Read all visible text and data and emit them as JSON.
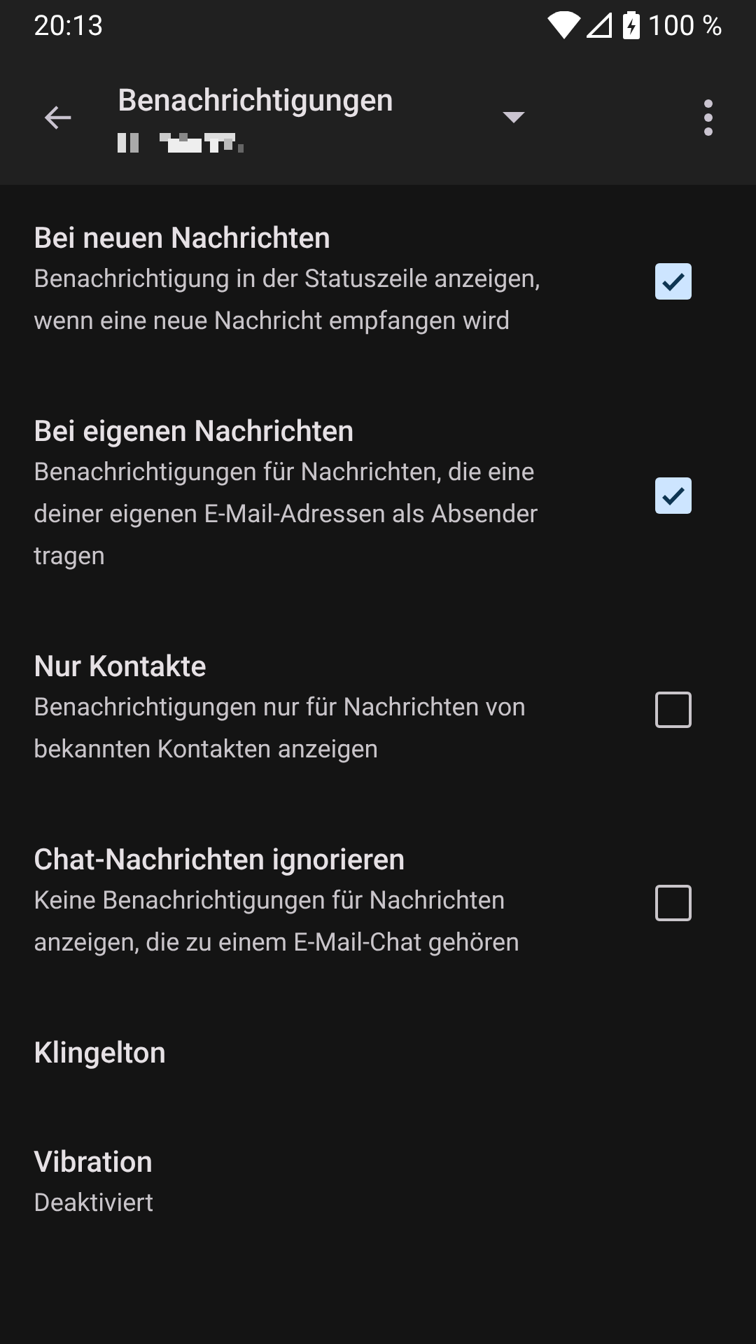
{
  "status_bar": {
    "time": "20:13",
    "battery": "100 %"
  },
  "app_bar": {
    "title": "Benachrichtigungen"
  },
  "settings": [
    {
      "kind": "checkbox",
      "title": "Bei neuen Nachrichten",
      "summary": "Benachrichtigung in der Statuszeile anzeigen, wenn eine neue Nachricht empfangen wird",
      "checked": true
    },
    {
      "kind": "checkbox",
      "title": "Bei eigenen Nachrichten",
      "summary": "Benachrichtigungen für Nachrichten, die eine deiner eigenen E-Mail-Adressen als Absender tragen",
      "checked": true
    },
    {
      "kind": "checkbox",
      "title": "Nur Kontakte",
      "summary": "Benachrichtigungen nur für Nachrichten von bekannten Kontakten anzeigen",
      "checked": false
    },
    {
      "kind": "checkbox",
      "title": "Chat-Nachrichten ignorieren",
      "summary": "Keine Benachrichtigungen für Nachrichten anzeigen, die zu einem E-Mail-Chat gehören",
      "checked": false
    },
    {
      "kind": "link",
      "title": "Klingelton"
    },
    {
      "kind": "link",
      "title": "Vibration",
      "summary": "Deaktiviert"
    }
  ]
}
